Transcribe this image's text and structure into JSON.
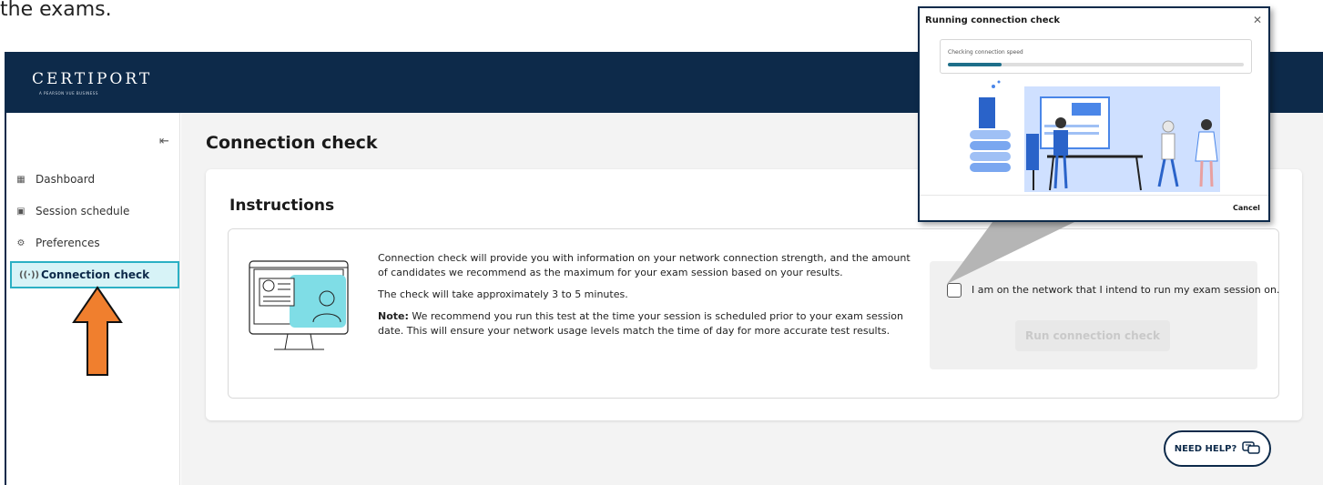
{
  "page": {
    "top_text": "the exams."
  },
  "brand": {
    "name": "CERTIPORT",
    "tagline": "A PEARSON VUE BUSINESS"
  },
  "sidebar": {
    "collapse_icon": "collapse-left-icon",
    "items": [
      {
        "label": "Dashboard",
        "icon": "grid-icon"
      },
      {
        "label": "Session schedule",
        "icon": "calendar-icon"
      },
      {
        "label": "Preferences",
        "icon": "gear-icon"
      },
      {
        "label": "Connection check",
        "icon": "wifi-signal-icon",
        "active": true
      }
    ]
  },
  "main": {
    "title": "Connection check",
    "instructions_title": "Instructions",
    "paragraph1": "Connection check will provide you with information on your network connection strength, and the amount of candidates we recommend as the maximum for your exam session based on your results.",
    "paragraph2": "The check will take approximately 3 to 5 minutes.",
    "note_label": "Note:",
    "note_text": " We recommend you run this test at the time your session is scheduled prior to your exam session date. This will ensure your network usage levels match the time of day for more accurate test results.",
    "checkbox_label": "I am on the network that I intend to run my exam session on.",
    "run_button": "Run connection check",
    "need_help": "NEED HELP?"
  },
  "modal": {
    "title": "Running connection check",
    "close_icon": "close-icon",
    "progress_label": "Checking connection speed",
    "progress": 0.18,
    "cancel": "Cancel"
  },
  "colors": {
    "navy": "#0d2a4a",
    "accent_teal": "#2bb0c4",
    "arrow_orange": "#f07f2e",
    "illustration_blue": "#4a86e8"
  }
}
